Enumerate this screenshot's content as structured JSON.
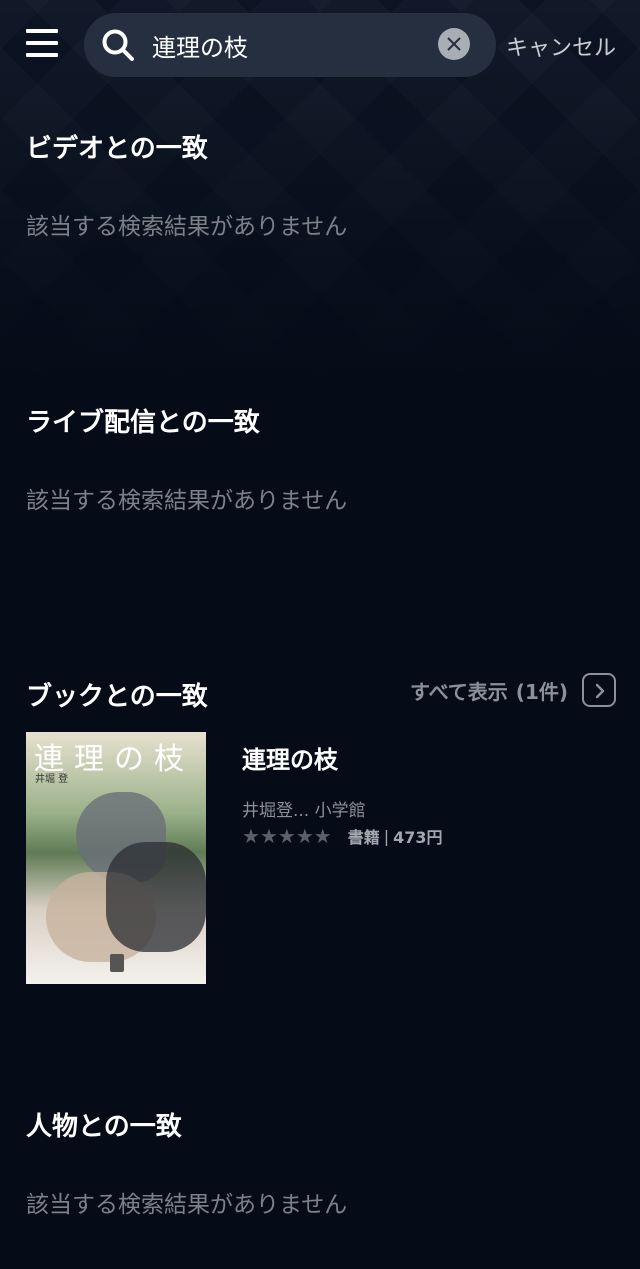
{
  "header": {
    "search_value": "連理の枝",
    "cancel_label": "キャンセル"
  },
  "sections": {
    "video": {
      "title": "ビデオとの一致",
      "empty_message": "該当する検索結果がありません"
    },
    "live": {
      "title": "ライブ配信との一致",
      "empty_message": "該当する検索結果がありません"
    },
    "book": {
      "title": "ブックとの一致",
      "see_all_label": "すべて表示",
      "see_all_count": "(1件)",
      "items": [
        {
          "title": "連理の枝",
          "cover_title": "連理の枝",
          "cover_author": "井堀 登",
          "meta": "井堀登... 小学館",
          "rating": 0,
          "stars": [
            "★",
            "★",
            "★",
            "★",
            "★"
          ],
          "type": "書籍",
          "divider": "|",
          "price": "473円"
        }
      ]
    },
    "person": {
      "title": "人物との一致",
      "empty_message": "該当する検索結果がありません"
    }
  },
  "colors": {
    "background": "#050b17",
    "search_box": "#252f3f",
    "muted_text": "#7c8089",
    "star_empty": "#5b6068"
  }
}
